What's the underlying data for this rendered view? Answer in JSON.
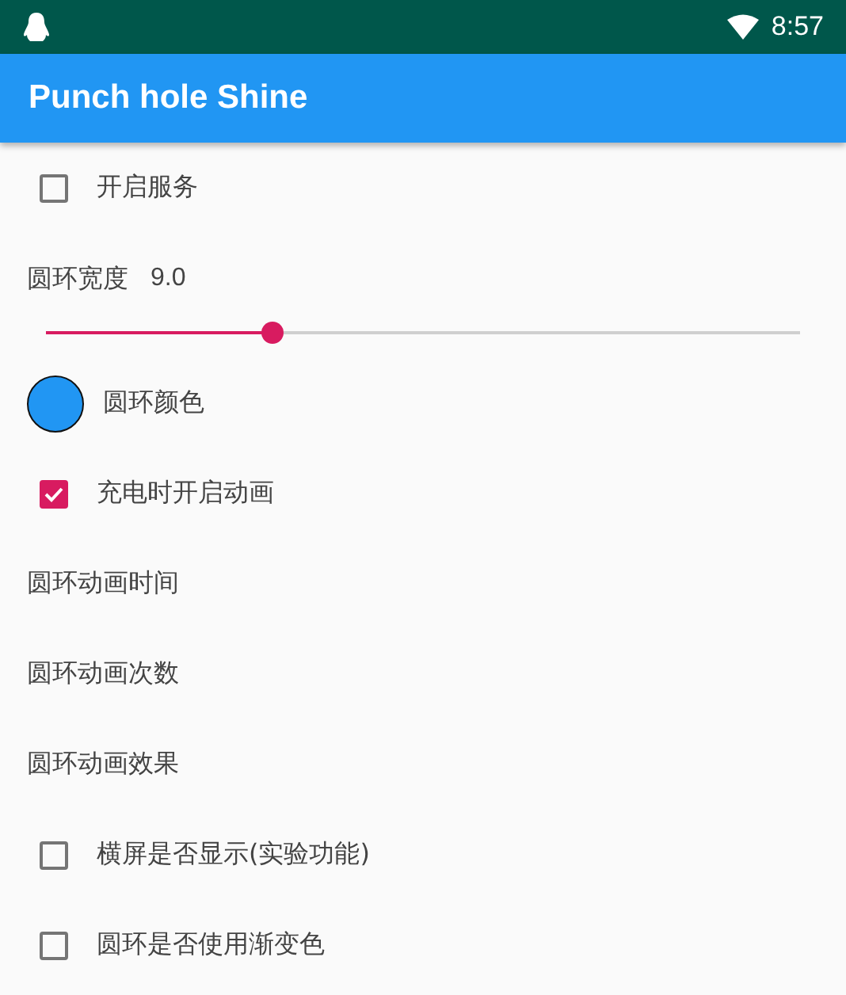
{
  "status_bar": {
    "time": "8:57"
  },
  "app_bar": {
    "title": "Punch hole Shine"
  },
  "settings": [
    {
      "kind": "checkbox",
      "label": "开启服务",
      "checked": false
    },
    {
      "kind": "slider",
      "label": "圆环宽度",
      "value": "9.0",
      "level": 0.3
    },
    {
      "kind": "color",
      "label": "圆环颜色",
      "color": "#2196f3"
    },
    {
      "kind": "checkbox",
      "label": "充电时开启动画",
      "checked": true
    },
    {
      "kind": "text",
      "label": "圆环动画时间"
    },
    {
      "kind": "text",
      "label": "圆环动画次数"
    },
    {
      "kind": "text",
      "label": "圆环动画效果"
    },
    {
      "kind": "checkbox",
      "label": "横屏是否显示(实验功能)",
      "checked": false
    },
    {
      "kind": "checkbox",
      "label": "圆环是否使用渐变色",
      "checked": false
    }
  ]
}
